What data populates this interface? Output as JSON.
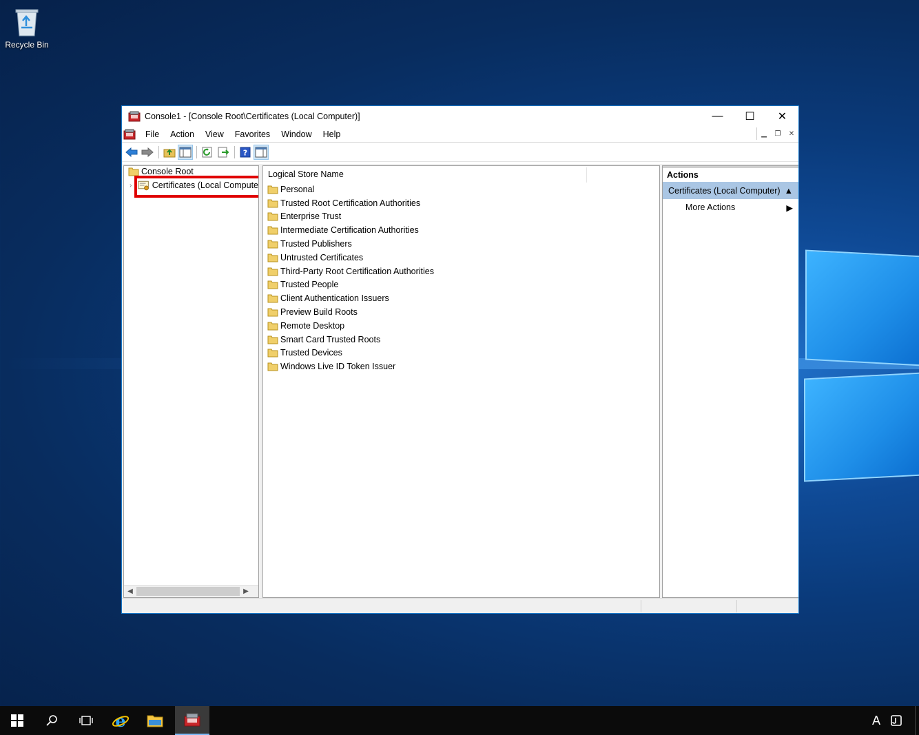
{
  "desktop": {
    "recycle_bin_label": "Recycle Bin"
  },
  "window": {
    "title": "Console1 - [Console Root\\Certificates (Local Computer)]",
    "controls": {
      "minimize": "—",
      "maximize": "☐",
      "close": "✕"
    }
  },
  "menubar": {
    "items": [
      "File",
      "Action",
      "View",
      "Favorites",
      "Window",
      "Help"
    ]
  },
  "toolbar": {
    "icons": [
      "back-icon",
      "forward-icon",
      "up-folder-icon",
      "show-hide-tree-icon",
      "refresh-icon",
      "export-list-icon",
      "help-icon",
      "show-hide-action-pane-icon"
    ]
  },
  "tree": {
    "root_label": "Console Root",
    "child_label": "Certificates (Local Compute",
    "highlight_color": "#e00000"
  },
  "list": {
    "column_header": "Logical Store Name",
    "rows": [
      "Personal",
      "Trusted Root Certification Authorities",
      "Enterprise Trust",
      "Intermediate Certification Authorities",
      "Trusted Publishers",
      "Untrusted Certificates",
      "Third-Party Root Certification Authorities",
      "Trusted People",
      "Client Authentication Issuers",
      "Preview Build Roots",
      "Remote Desktop",
      "Smart Card Trusted Roots",
      "Trusted Devices",
      "Windows Live ID Token Issuer"
    ]
  },
  "actions": {
    "header": "Actions",
    "section_title": "Certificates (Local Computer)",
    "more_actions": "More Actions",
    "section_color": "#aac6e4"
  },
  "taskbar": {
    "tray_ime": "A"
  }
}
